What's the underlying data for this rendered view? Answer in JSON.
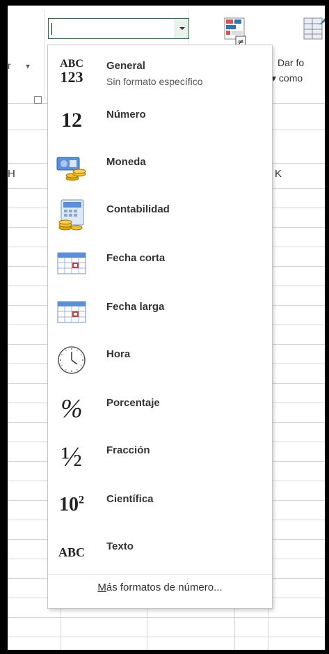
{
  "ribbon": {
    "left_text": "r",
    "dar_formato": "Dar fo",
    "como": "como",
    "combo_value": ""
  },
  "sheet": {
    "col_h": "H",
    "col_k": "K"
  },
  "menu": {
    "items": [
      {
        "label": "General",
        "sub": "Sin formato específico",
        "icon": "abc-123-icon",
        "glyph_top": "ABC",
        "glyph_bottom": "123"
      },
      {
        "label": "Número",
        "icon": "number-12-icon",
        "glyph": "12"
      },
      {
        "label": "Moneda",
        "icon": "currency-coins-icon"
      },
      {
        "label": "Contabilidad",
        "icon": "accounting-calculator-icon"
      },
      {
        "label": "Fecha corta",
        "icon": "calendar-short-icon"
      },
      {
        "label": "Fecha larga",
        "icon": "calendar-long-icon"
      },
      {
        "label": "Hora",
        "icon": "clock-icon"
      },
      {
        "label": "Porcentaje",
        "icon": "percent-icon",
        "glyph": "%"
      },
      {
        "label": "Fracción",
        "icon": "fraction-icon",
        "glyph": "½"
      },
      {
        "label": "Científica",
        "icon": "scientific-icon",
        "glyph": "10",
        "glyph_sup": "2"
      },
      {
        "label": "Texto",
        "icon": "text-abc-icon",
        "glyph": "ABC"
      }
    ],
    "more_prefix": "M",
    "more_rest": "ás formatos de número..."
  },
  "colors": {
    "accent": "#217346",
    "border": "#c6c6c6",
    "grid": "#d4d4d4"
  }
}
